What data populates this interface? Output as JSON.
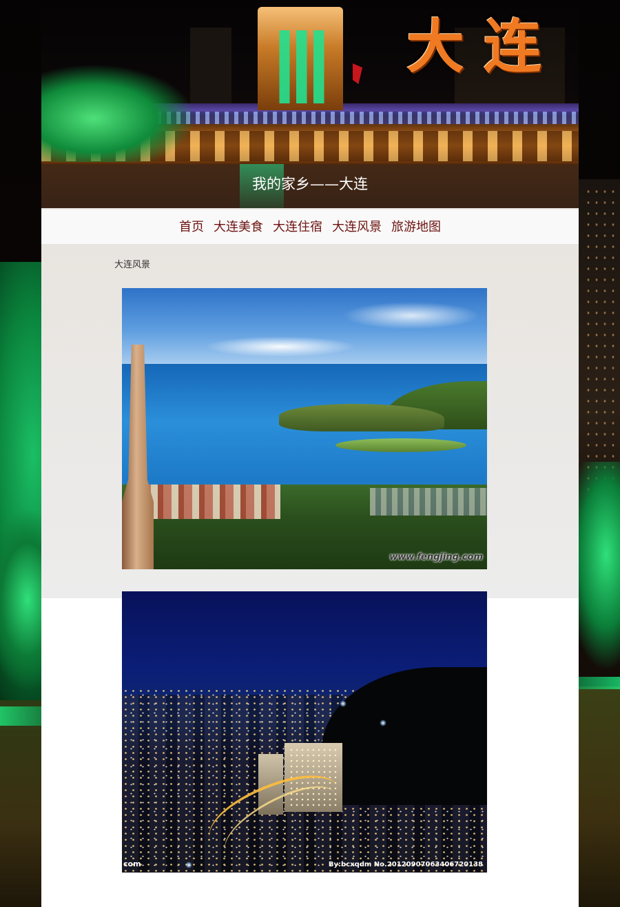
{
  "header": {
    "logo_text": "大连",
    "site_title": "我的家乡——大连"
  },
  "nav": {
    "items": [
      {
        "label": "首页"
      },
      {
        "label": "大连美食"
      },
      {
        "label": "大连住宿"
      },
      {
        "label": "大连风景"
      },
      {
        "label": "旅游地图"
      }
    ]
  },
  "breadcrumb": "大连风景",
  "photos": [
    {
      "watermark": "www.fengjing.com"
    },
    {
      "watermark_left": "com",
      "watermark_right": "By:bcxqdm  No.20120907063406720138"
    }
  ],
  "colors": {
    "nav_text": "#6b1310",
    "logo": "#ef7a22",
    "title_bar": "#361804"
  }
}
